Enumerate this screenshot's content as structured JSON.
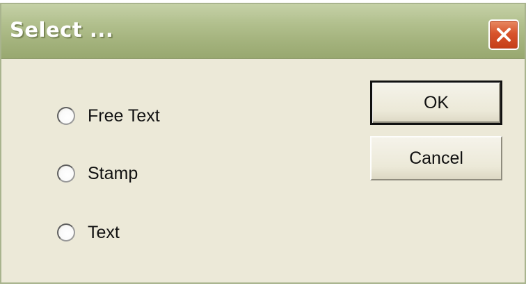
{
  "window": {
    "title": "Select ..."
  },
  "options": [
    {
      "label": "Free Text",
      "selected": false
    },
    {
      "label": "Stamp",
      "selected": false
    },
    {
      "label": "Text",
      "selected": false
    }
  ],
  "buttons": {
    "ok_label": "OK",
    "cancel_label": "Cancel"
  },
  "colors": {
    "titlebar": "#b2c08e",
    "dialog_bg": "#ece9d8",
    "close_button": "#d8542c"
  }
}
